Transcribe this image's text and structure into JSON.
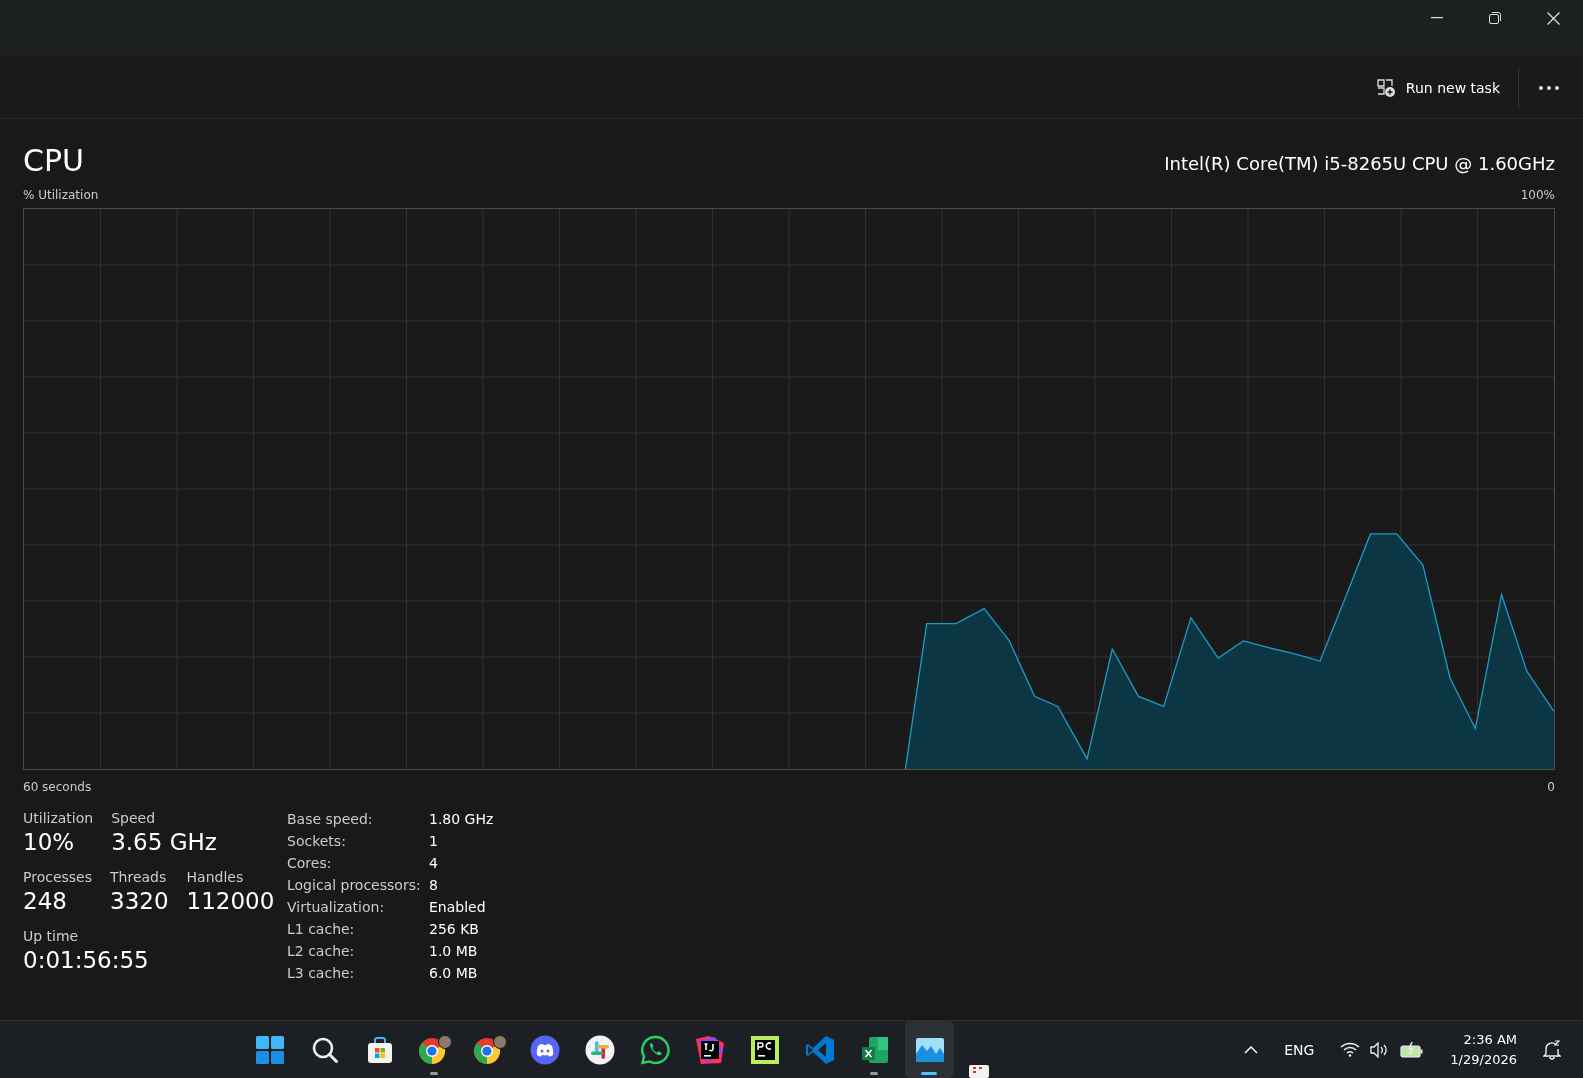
{
  "command_bar": {
    "run_task_label": "Run new task"
  },
  "header": {
    "title": "CPU",
    "processor": "Intel(R) Core(TM) i5-8265U CPU @ 1.60GHz"
  },
  "graph": {
    "y_label": "% Utilization",
    "y_max": "100%",
    "x_label": "60 seconds",
    "x_min": "0"
  },
  "stats": [
    [
      {
        "label": "Utilization",
        "value": "10%"
      },
      {
        "label": "Speed",
        "value": "3.65 GHz"
      }
    ],
    [
      {
        "label": "Processes",
        "value": "248"
      },
      {
        "label": "Threads",
        "value": "3320"
      },
      {
        "label": "Handles",
        "value": "112000"
      }
    ],
    [
      {
        "label": "Up time",
        "value": "0:01:56:55"
      }
    ]
  ],
  "details": [
    {
      "label": "Base speed:",
      "value": "1.80 GHz"
    },
    {
      "label": "Sockets:",
      "value": "1"
    },
    {
      "label": "Cores:",
      "value": "4"
    },
    {
      "label": "Logical processors:",
      "value": "8"
    },
    {
      "label": "Virtualization:",
      "value": "Enabled"
    },
    {
      "label": "L1 cache:",
      "value": "256 KB"
    },
    {
      "label": "L2 cache:",
      "value": "1.0 MB"
    },
    {
      "label": "L3 cache:",
      "value": "6.0 MB"
    }
  ],
  "taskbar": {
    "apps": [
      {
        "kind": "start",
        "running": false,
        "selected": false
      },
      {
        "kind": "search",
        "running": false,
        "selected": false
      },
      {
        "kind": "store",
        "running": false,
        "selected": false
      },
      {
        "kind": "chrome",
        "running": true,
        "selected": false
      },
      {
        "kind": "chrome",
        "running": false,
        "selected": false
      },
      {
        "kind": "discord",
        "running": false,
        "selected": false
      },
      {
        "kind": "slack",
        "running": false,
        "selected": false
      },
      {
        "kind": "whatsapp",
        "running": false,
        "selected": false
      },
      {
        "kind": "intellij",
        "running": false,
        "selected": false
      },
      {
        "kind": "pycharm",
        "running": false,
        "selected": false
      },
      {
        "kind": "vscode",
        "running": false,
        "selected": false
      },
      {
        "kind": "excel",
        "running": true,
        "selected": false
      },
      {
        "kind": "taskmanager",
        "running": true,
        "selected": true
      }
    ],
    "language": "ENG",
    "time": "2:36 AM",
    "date": "1/29/2026"
  }
}
